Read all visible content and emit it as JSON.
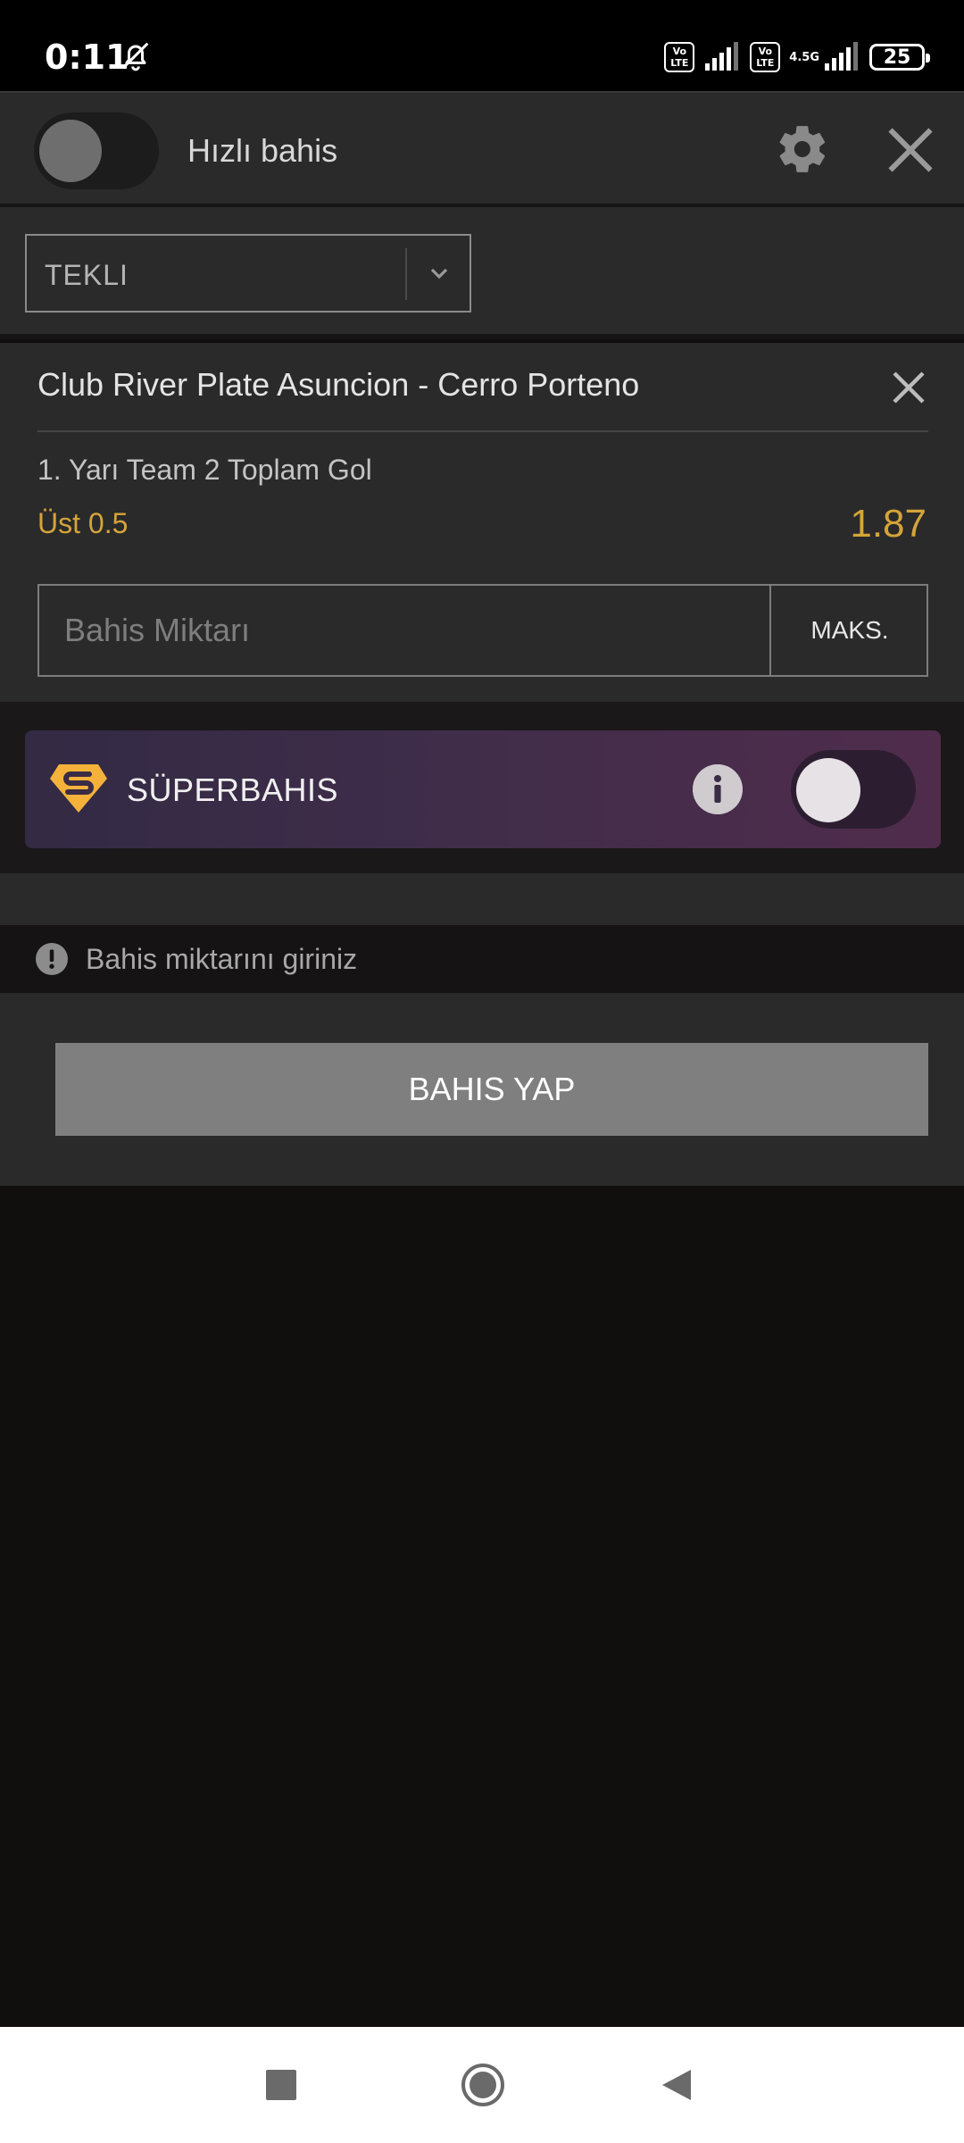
{
  "status_bar": {
    "time": "0:11",
    "volte_1": "Vo LTE",
    "volte_2": "Vo LTE",
    "network_type": "4.5G",
    "battery": "25",
    "icons": [
      "bell-off-icon",
      "signal-icon",
      "battery-icon"
    ]
  },
  "header": {
    "quick_bet_label": "Hızlı bahis",
    "quick_bet_on": false,
    "icons": [
      "gear-icon",
      "close-icon"
    ]
  },
  "bet_type": {
    "selected": "TEKLI"
  },
  "bet": {
    "match": "Club River Plate Asuncion - Cerro Porteno",
    "market": "1. Yarı Team 2 Toplam Gol",
    "selection": "Üst 0.5",
    "odds": "1.87",
    "stake_placeholder": "Bahis Miktarı",
    "max_label": "MAKS."
  },
  "superbet": {
    "label": "SÜPERBAHIS",
    "enabled": false
  },
  "warning": {
    "text": "Bahis miktarını giriniz"
  },
  "actions": {
    "place_bet_label": "BAHIS YAP"
  },
  "colors": {
    "accent_gold": "#d5a43a",
    "panel": "#2a2a2a",
    "background": "#110e0e",
    "superbet_gradient_start": "#332a44",
    "superbet_gradient_end": "#502c4c"
  }
}
